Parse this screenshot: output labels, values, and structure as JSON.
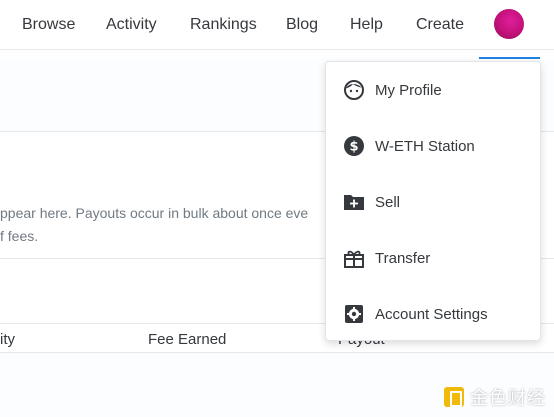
{
  "nav": {
    "items": [
      {
        "label": "Browse"
      },
      {
        "label": "Activity"
      },
      {
        "label": "Rankings"
      },
      {
        "label": "Blog"
      },
      {
        "label": "Help"
      },
      {
        "label": "Create"
      }
    ]
  },
  "page": {
    "description_line1": "ppear here. Payouts occur in bulk about once eve",
    "description_line2": "f fees.",
    "table_headers": [
      "ity",
      "Fee Earned",
      "Payout"
    ]
  },
  "menu": {
    "items": [
      {
        "label": "My Profile",
        "icon": "face-icon"
      },
      {
        "label": "W-ETH Station",
        "icon": "dollar-circle-icon"
      },
      {
        "label": "Sell",
        "icon": "folder-plus-icon"
      },
      {
        "label": "Transfer",
        "icon": "gift-icon"
      },
      {
        "label": "Account Settings",
        "icon": "gear-icon"
      }
    ]
  },
  "watermark": {
    "text": "金色财经"
  },
  "colors": {
    "accent": "#2081e2",
    "text": "#35383d",
    "muted": "#707a83",
    "avatar": "#c11178",
    "watermark_logo": "#f0b90b"
  }
}
